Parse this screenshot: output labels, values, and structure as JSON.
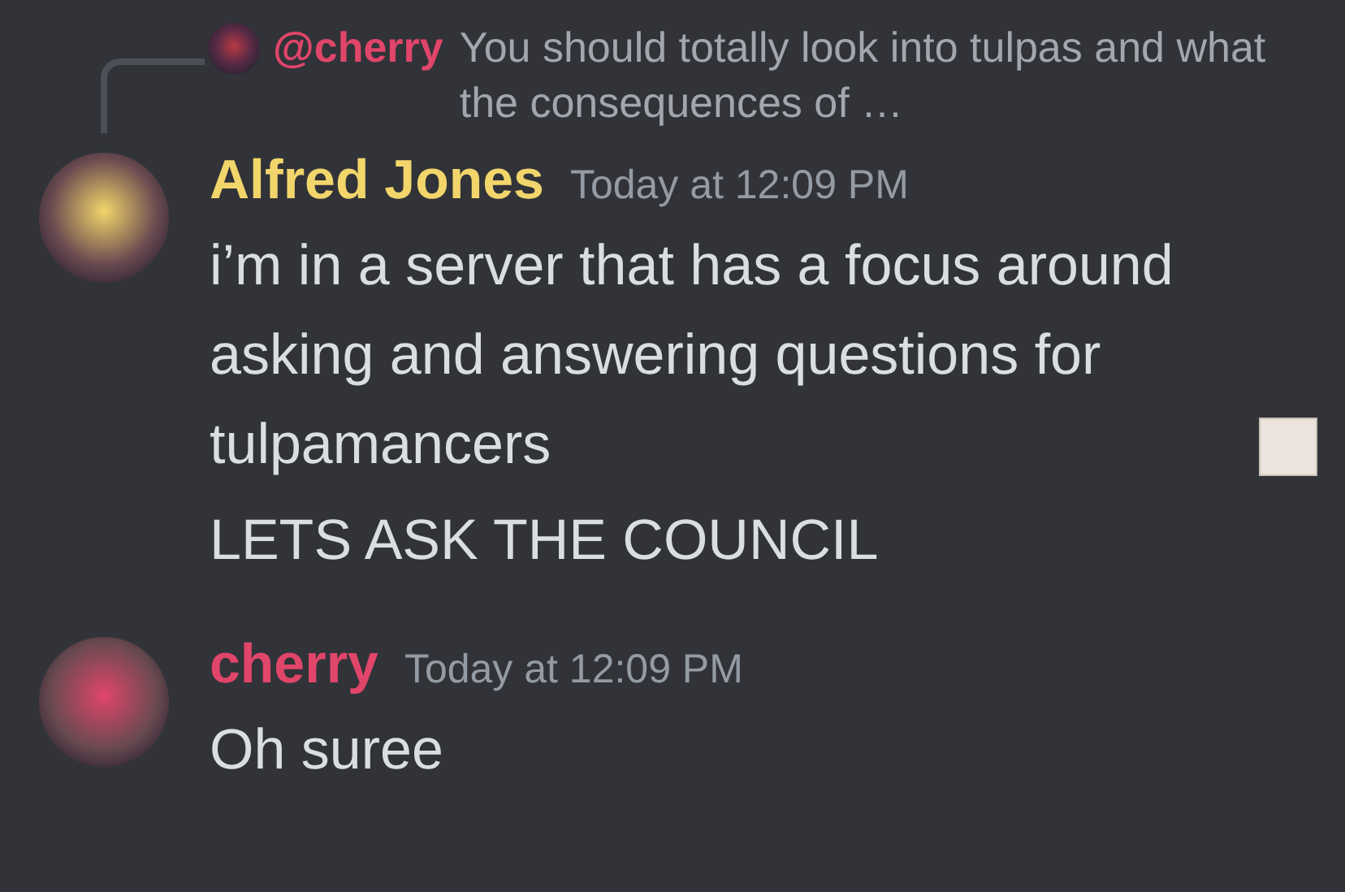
{
  "messages": [
    {
      "reply": {
        "author": "@cherry",
        "color": "#e0456a",
        "text": "You should totally look into tulpas and what the consequences of …"
      },
      "author": "Alfred Jones",
      "color": "#f2d56b",
      "timestamp": "Today at 12:09 PM",
      "lines": [
        {
          "text": "i’m in a server that has a focus around asking and answering questions for tulpamancers",
          "emoji": true
        },
        {
          "text": "LETS ASK THE COUNCIL",
          "emoji": false
        }
      ]
    },
    {
      "author": "cherry",
      "color": "#e0456a",
      "timestamp": "Today at 12:09 PM",
      "lines": [
        {
          "text": "Oh suree",
          "emoji": false
        }
      ]
    }
  ]
}
